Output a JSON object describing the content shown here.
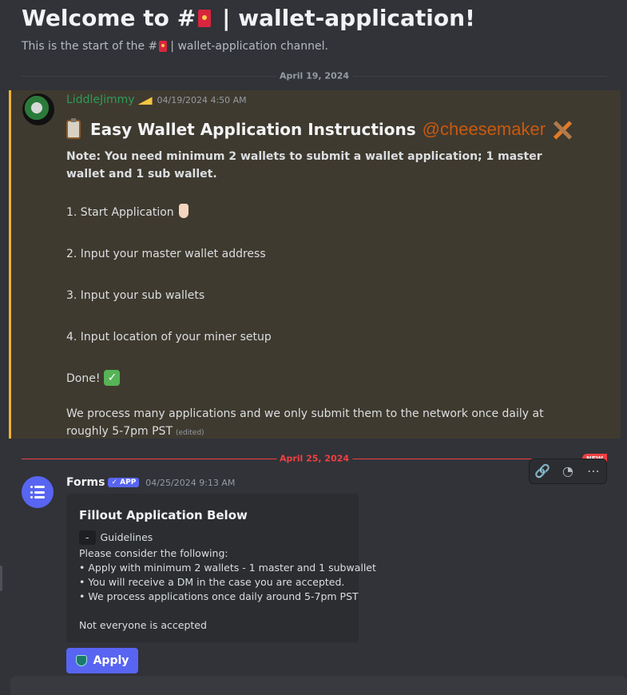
{
  "channel": {
    "welcome_prefix": "Welcome to #",
    "welcome_suffix": "wallet-application!",
    "separator": "|",
    "subtitle_prefix": "This is the start of the #",
    "subtitle_suffix": "| wallet-application channel."
  },
  "dividers": [
    {
      "date": "April 19, 2024"
    },
    {
      "date": "April 25, 2024",
      "badge": "NEW"
    }
  ],
  "message1": {
    "author": "LiddleJimmy",
    "author_color": "#2d9b59",
    "timestamp": "04/19/2024 4:50 AM",
    "title": "Easy Wallet Application Instructions",
    "mention": "@cheesemaker",
    "note": "Note: You need minimum 2 wallets to submit a wallet application; 1 master wallet and 1 sub wallet.",
    "steps": [
      "1. Start Application",
      "2. Input your master wallet address",
      "3. Input your sub wallets",
      "4. Input location of your miner setup"
    ],
    "done": "Done!",
    "final": "We process many applications and we only submit them to the network once daily at roughly 5-7pm PST",
    "edited": "(edited)"
  },
  "message2": {
    "author": "Forms",
    "badge": "✓ APP",
    "timestamp": "04/25/2024 9:13 AM",
    "embed": {
      "title": "Fillout Application Below",
      "chip": "-",
      "guidelines": "Guidelines",
      "lines": [
        "Please consider the following:",
        "• Apply with minimum 2 wallets - 1 master and 1 subwallet",
        "• You will receive a DM in the case you are accepted.",
        "• We process applications once daily around 5-7pm PST"
      ],
      "footer": "Not everyone is accepted"
    },
    "button": "Apply",
    "toolbar": [
      "link-icon",
      "reply-thread-icon",
      "more-icon"
    ]
  }
}
